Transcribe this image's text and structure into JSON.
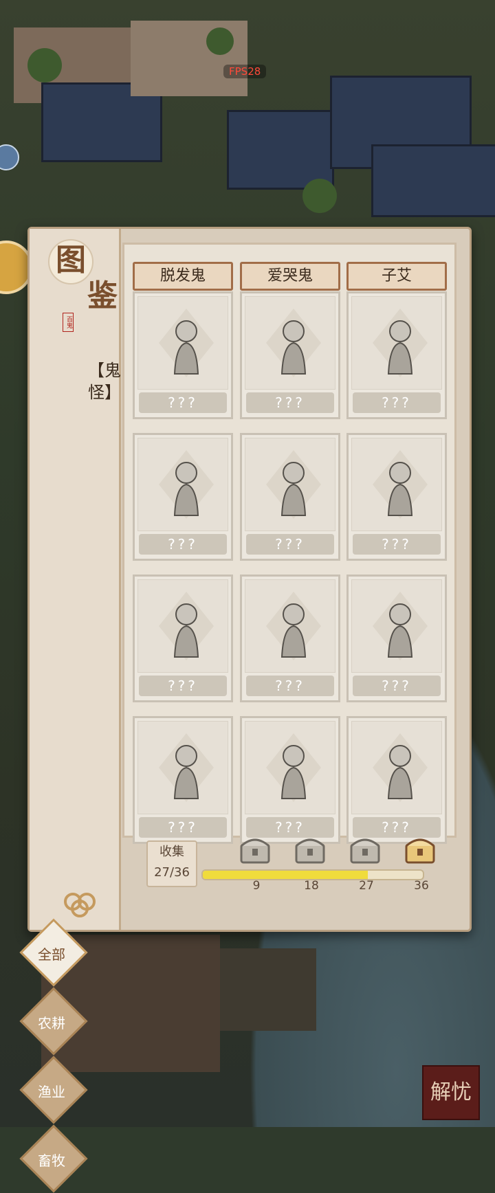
{
  "hud": {
    "fps": "FPS28"
  },
  "book": {
    "title_chars": [
      "图",
      "鉴"
    ],
    "seal_text": "百鬼",
    "category": "【鬼怪】",
    "tabs": [
      {
        "label": "全部",
        "active": true
      },
      {
        "label": "农耕",
        "active": false
      },
      {
        "label": "渔业",
        "active": false
      },
      {
        "label": "畜牧",
        "active": false
      }
    ],
    "columns": [
      "脱发鬼",
      "爱哭鬼",
      "子艾"
    ],
    "cards": [
      {
        "label": "???",
        "icon": "ghost-scholar-icon"
      },
      {
        "label": "???",
        "icon": "hanging-ghost-icon"
      },
      {
        "label": "???",
        "icon": "girl-bun-icon"
      },
      {
        "label": "???",
        "icon": "sack-carrier-icon"
      },
      {
        "label": "???",
        "icon": "monk-staff-icon"
      },
      {
        "label": "???",
        "icon": "dancer-fan-icon"
      },
      {
        "label": "???",
        "icon": "rabbit-maiden-icon"
      },
      {
        "label": "???",
        "icon": "bunny-figure-icon"
      },
      {
        "label": "???",
        "icon": "warrior-dragon-icon"
      },
      {
        "label": "???",
        "icon": "fortune-god-icon"
      },
      {
        "label": "???",
        "icon": "white-robe-ghost-icon"
      },
      {
        "label": "???",
        "icon": "palanquin-ghost-icon"
      }
    ],
    "collect": {
      "label": "收集",
      "count_text": "27/36",
      "progress": 0.75,
      "milestones": [
        "9",
        "18",
        "27",
        "36"
      ]
    }
  },
  "corner_stamp": "解忧"
}
